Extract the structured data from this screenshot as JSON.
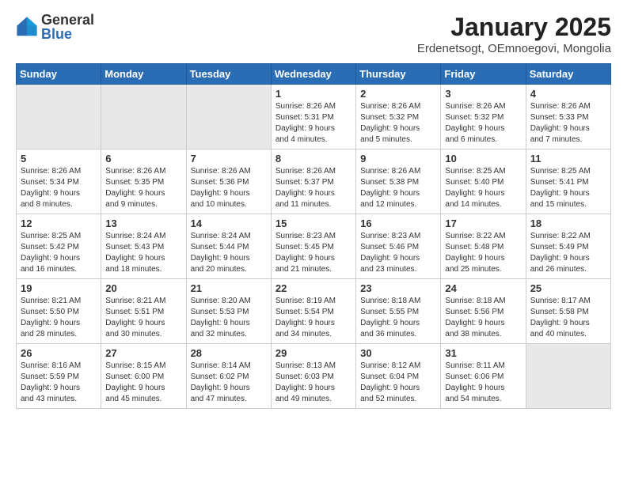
{
  "logo": {
    "general": "General",
    "blue": "Blue"
  },
  "title": "January 2025",
  "subtitle": "Erdenetsogt, OEmnoegovi, Mongolia",
  "headers": [
    "Sunday",
    "Monday",
    "Tuesday",
    "Wednesday",
    "Thursday",
    "Friday",
    "Saturday"
  ],
  "weeks": [
    [
      {
        "num": "",
        "info": ""
      },
      {
        "num": "",
        "info": ""
      },
      {
        "num": "",
        "info": ""
      },
      {
        "num": "1",
        "info": "Sunrise: 8:26 AM\nSunset: 5:31 PM\nDaylight: 9 hours\nand 4 minutes."
      },
      {
        "num": "2",
        "info": "Sunrise: 8:26 AM\nSunset: 5:32 PM\nDaylight: 9 hours\nand 5 minutes."
      },
      {
        "num": "3",
        "info": "Sunrise: 8:26 AM\nSunset: 5:32 PM\nDaylight: 9 hours\nand 6 minutes."
      },
      {
        "num": "4",
        "info": "Sunrise: 8:26 AM\nSunset: 5:33 PM\nDaylight: 9 hours\nand 7 minutes."
      }
    ],
    [
      {
        "num": "5",
        "info": "Sunrise: 8:26 AM\nSunset: 5:34 PM\nDaylight: 9 hours\nand 8 minutes."
      },
      {
        "num": "6",
        "info": "Sunrise: 8:26 AM\nSunset: 5:35 PM\nDaylight: 9 hours\nand 9 minutes."
      },
      {
        "num": "7",
        "info": "Sunrise: 8:26 AM\nSunset: 5:36 PM\nDaylight: 9 hours\nand 10 minutes."
      },
      {
        "num": "8",
        "info": "Sunrise: 8:26 AM\nSunset: 5:37 PM\nDaylight: 9 hours\nand 11 minutes."
      },
      {
        "num": "9",
        "info": "Sunrise: 8:26 AM\nSunset: 5:38 PM\nDaylight: 9 hours\nand 12 minutes."
      },
      {
        "num": "10",
        "info": "Sunrise: 8:25 AM\nSunset: 5:40 PM\nDaylight: 9 hours\nand 14 minutes."
      },
      {
        "num": "11",
        "info": "Sunrise: 8:25 AM\nSunset: 5:41 PM\nDaylight: 9 hours\nand 15 minutes."
      }
    ],
    [
      {
        "num": "12",
        "info": "Sunrise: 8:25 AM\nSunset: 5:42 PM\nDaylight: 9 hours\nand 16 minutes."
      },
      {
        "num": "13",
        "info": "Sunrise: 8:24 AM\nSunset: 5:43 PM\nDaylight: 9 hours\nand 18 minutes."
      },
      {
        "num": "14",
        "info": "Sunrise: 8:24 AM\nSunset: 5:44 PM\nDaylight: 9 hours\nand 20 minutes."
      },
      {
        "num": "15",
        "info": "Sunrise: 8:23 AM\nSunset: 5:45 PM\nDaylight: 9 hours\nand 21 minutes."
      },
      {
        "num": "16",
        "info": "Sunrise: 8:23 AM\nSunset: 5:46 PM\nDaylight: 9 hours\nand 23 minutes."
      },
      {
        "num": "17",
        "info": "Sunrise: 8:22 AM\nSunset: 5:48 PM\nDaylight: 9 hours\nand 25 minutes."
      },
      {
        "num": "18",
        "info": "Sunrise: 8:22 AM\nSunset: 5:49 PM\nDaylight: 9 hours\nand 26 minutes."
      }
    ],
    [
      {
        "num": "19",
        "info": "Sunrise: 8:21 AM\nSunset: 5:50 PM\nDaylight: 9 hours\nand 28 minutes."
      },
      {
        "num": "20",
        "info": "Sunrise: 8:21 AM\nSunset: 5:51 PM\nDaylight: 9 hours\nand 30 minutes."
      },
      {
        "num": "21",
        "info": "Sunrise: 8:20 AM\nSunset: 5:53 PM\nDaylight: 9 hours\nand 32 minutes."
      },
      {
        "num": "22",
        "info": "Sunrise: 8:19 AM\nSunset: 5:54 PM\nDaylight: 9 hours\nand 34 minutes."
      },
      {
        "num": "23",
        "info": "Sunrise: 8:18 AM\nSunset: 5:55 PM\nDaylight: 9 hours\nand 36 minutes."
      },
      {
        "num": "24",
        "info": "Sunrise: 8:18 AM\nSunset: 5:56 PM\nDaylight: 9 hours\nand 38 minutes."
      },
      {
        "num": "25",
        "info": "Sunrise: 8:17 AM\nSunset: 5:58 PM\nDaylight: 9 hours\nand 40 minutes."
      }
    ],
    [
      {
        "num": "26",
        "info": "Sunrise: 8:16 AM\nSunset: 5:59 PM\nDaylight: 9 hours\nand 43 minutes."
      },
      {
        "num": "27",
        "info": "Sunrise: 8:15 AM\nSunset: 6:00 PM\nDaylight: 9 hours\nand 45 minutes."
      },
      {
        "num": "28",
        "info": "Sunrise: 8:14 AM\nSunset: 6:02 PM\nDaylight: 9 hours\nand 47 minutes."
      },
      {
        "num": "29",
        "info": "Sunrise: 8:13 AM\nSunset: 6:03 PM\nDaylight: 9 hours\nand 49 minutes."
      },
      {
        "num": "30",
        "info": "Sunrise: 8:12 AM\nSunset: 6:04 PM\nDaylight: 9 hours\nand 52 minutes."
      },
      {
        "num": "31",
        "info": "Sunrise: 8:11 AM\nSunset: 6:06 PM\nDaylight: 9 hours\nand 54 minutes."
      },
      {
        "num": "",
        "info": ""
      }
    ]
  ]
}
